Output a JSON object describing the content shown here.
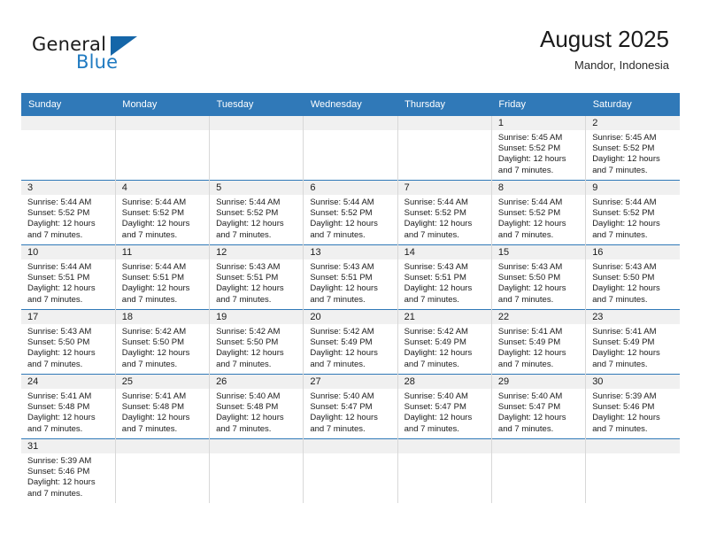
{
  "brand": {
    "name_top": "General",
    "name_bottom": "Blue",
    "triangle_color": "#1566a8",
    "blue_color": "#1f7ac1"
  },
  "header": {
    "title": "August 2025",
    "subtitle": "Mandor, Indonesia",
    "header_bg": "#3079b8",
    "daynum_band_bg": "#f0f0f0"
  },
  "weekdays": [
    "Sunday",
    "Monday",
    "Tuesday",
    "Wednesday",
    "Thursday",
    "Friday",
    "Saturday"
  ],
  "labels": {
    "sunrise_prefix": "Sunrise:",
    "sunset_prefix": "Sunset:",
    "daylight_prefix": "Daylight:"
  },
  "weeks": [
    [
      {
        "day": "",
        "sunrise": "",
        "sunset": "",
        "daylight": "",
        "empty": true
      },
      {
        "day": "",
        "sunrise": "",
        "sunset": "",
        "daylight": "",
        "empty": true
      },
      {
        "day": "",
        "sunrise": "",
        "sunset": "",
        "daylight": "",
        "empty": true
      },
      {
        "day": "",
        "sunrise": "",
        "sunset": "",
        "daylight": "",
        "empty": true
      },
      {
        "day": "",
        "sunrise": "",
        "sunset": "",
        "daylight": "",
        "empty": true
      },
      {
        "day": "1",
        "sunrise": "Sunrise: 5:45 AM",
        "sunset": "Sunset: 5:52 PM",
        "daylight": "Daylight: 12 hours and 7 minutes.",
        "empty": false
      },
      {
        "day": "2",
        "sunrise": "Sunrise: 5:45 AM",
        "sunset": "Sunset: 5:52 PM",
        "daylight": "Daylight: 12 hours and 7 minutes.",
        "empty": false
      }
    ],
    [
      {
        "day": "3",
        "sunrise": "Sunrise: 5:44 AM",
        "sunset": "Sunset: 5:52 PM",
        "daylight": "Daylight: 12 hours and 7 minutes.",
        "empty": false
      },
      {
        "day": "4",
        "sunrise": "Sunrise: 5:44 AM",
        "sunset": "Sunset: 5:52 PM",
        "daylight": "Daylight: 12 hours and 7 minutes.",
        "empty": false
      },
      {
        "day": "5",
        "sunrise": "Sunrise: 5:44 AM",
        "sunset": "Sunset: 5:52 PM",
        "daylight": "Daylight: 12 hours and 7 minutes.",
        "empty": false
      },
      {
        "day": "6",
        "sunrise": "Sunrise: 5:44 AM",
        "sunset": "Sunset: 5:52 PM",
        "daylight": "Daylight: 12 hours and 7 minutes.",
        "empty": false
      },
      {
        "day": "7",
        "sunrise": "Sunrise: 5:44 AM",
        "sunset": "Sunset: 5:52 PM",
        "daylight": "Daylight: 12 hours and 7 minutes.",
        "empty": false
      },
      {
        "day": "8",
        "sunrise": "Sunrise: 5:44 AM",
        "sunset": "Sunset: 5:52 PM",
        "daylight": "Daylight: 12 hours and 7 minutes.",
        "empty": false
      },
      {
        "day": "9",
        "sunrise": "Sunrise: 5:44 AM",
        "sunset": "Sunset: 5:52 PM",
        "daylight": "Daylight: 12 hours and 7 minutes.",
        "empty": false
      }
    ],
    [
      {
        "day": "10",
        "sunrise": "Sunrise: 5:44 AM",
        "sunset": "Sunset: 5:51 PM",
        "daylight": "Daylight: 12 hours and 7 minutes.",
        "empty": false
      },
      {
        "day": "11",
        "sunrise": "Sunrise: 5:44 AM",
        "sunset": "Sunset: 5:51 PM",
        "daylight": "Daylight: 12 hours and 7 minutes.",
        "empty": false
      },
      {
        "day": "12",
        "sunrise": "Sunrise: 5:43 AM",
        "sunset": "Sunset: 5:51 PM",
        "daylight": "Daylight: 12 hours and 7 minutes.",
        "empty": false
      },
      {
        "day": "13",
        "sunrise": "Sunrise: 5:43 AM",
        "sunset": "Sunset: 5:51 PM",
        "daylight": "Daylight: 12 hours and 7 minutes.",
        "empty": false
      },
      {
        "day": "14",
        "sunrise": "Sunrise: 5:43 AM",
        "sunset": "Sunset: 5:51 PM",
        "daylight": "Daylight: 12 hours and 7 minutes.",
        "empty": false
      },
      {
        "day": "15",
        "sunrise": "Sunrise: 5:43 AM",
        "sunset": "Sunset: 5:50 PM",
        "daylight": "Daylight: 12 hours and 7 minutes.",
        "empty": false
      },
      {
        "day": "16",
        "sunrise": "Sunrise: 5:43 AM",
        "sunset": "Sunset: 5:50 PM",
        "daylight": "Daylight: 12 hours and 7 minutes.",
        "empty": false
      }
    ],
    [
      {
        "day": "17",
        "sunrise": "Sunrise: 5:43 AM",
        "sunset": "Sunset: 5:50 PM",
        "daylight": "Daylight: 12 hours and 7 minutes.",
        "empty": false
      },
      {
        "day": "18",
        "sunrise": "Sunrise: 5:42 AM",
        "sunset": "Sunset: 5:50 PM",
        "daylight": "Daylight: 12 hours and 7 minutes.",
        "empty": false
      },
      {
        "day": "19",
        "sunrise": "Sunrise: 5:42 AM",
        "sunset": "Sunset: 5:50 PM",
        "daylight": "Daylight: 12 hours and 7 minutes.",
        "empty": false
      },
      {
        "day": "20",
        "sunrise": "Sunrise: 5:42 AM",
        "sunset": "Sunset: 5:49 PM",
        "daylight": "Daylight: 12 hours and 7 minutes.",
        "empty": false
      },
      {
        "day": "21",
        "sunrise": "Sunrise: 5:42 AM",
        "sunset": "Sunset: 5:49 PM",
        "daylight": "Daylight: 12 hours and 7 minutes.",
        "empty": false
      },
      {
        "day": "22",
        "sunrise": "Sunrise: 5:41 AM",
        "sunset": "Sunset: 5:49 PM",
        "daylight": "Daylight: 12 hours and 7 minutes.",
        "empty": false
      },
      {
        "day": "23",
        "sunrise": "Sunrise: 5:41 AM",
        "sunset": "Sunset: 5:49 PM",
        "daylight": "Daylight: 12 hours and 7 minutes.",
        "empty": false
      }
    ],
    [
      {
        "day": "24",
        "sunrise": "Sunrise: 5:41 AM",
        "sunset": "Sunset: 5:48 PM",
        "daylight": "Daylight: 12 hours and 7 minutes.",
        "empty": false
      },
      {
        "day": "25",
        "sunrise": "Sunrise: 5:41 AM",
        "sunset": "Sunset: 5:48 PM",
        "daylight": "Daylight: 12 hours and 7 minutes.",
        "empty": false
      },
      {
        "day": "26",
        "sunrise": "Sunrise: 5:40 AM",
        "sunset": "Sunset: 5:48 PM",
        "daylight": "Daylight: 12 hours and 7 minutes.",
        "empty": false
      },
      {
        "day": "27",
        "sunrise": "Sunrise: 5:40 AM",
        "sunset": "Sunset: 5:47 PM",
        "daylight": "Daylight: 12 hours and 7 minutes.",
        "empty": false
      },
      {
        "day": "28",
        "sunrise": "Sunrise: 5:40 AM",
        "sunset": "Sunset: 5:47 PM",
        "daylight": "Daylight: 12 hours and 7 minutes.",
        "empty": false
      },
      {
        "day": "29",
        "sunrise": "Sunrise: 5:40 AM",
        "sunset": "Sunset: 5:47 PM",
        "daylight": "Daylight: 12 hours and 7 minutes.",
        "empty": false
      },
      {
        "day": "30",
        "sunrise": "Sunrise: 5:39 AM",
        "sunset": "Sunset: 5:46 PM",
        "daylight": "Daylight: 12 hours and 7 minutes.",
        "empty": false
      }
    ],
    [
      {
        "day": "31",
        "sunrise": "Sunrise: 5:39 AM",
        "sunset": "Sunset: 5:46 PM",
        "daylight": "Daylight: 12 hours and 7 minutes.",
        "empty": false
      },
      {
        "day": "",
        "sunrise": "",
        "sunset": "",
        "daylight": "",
        "empty": true
      },
      {
        "day": "",
        "sunrise": "",
        "sunset": "",
        "daylight": "",
        "empty": true
      },
      {
        "day": "",
        "sunrise": "",
        "sunset": "",
        "daylight": "",
        "empty": true
      },
      {
        "day": "",
        "sunrise": "",
        "sunset": "",
        "daylight": "",
        "empty": true
      },
      {
        "day": "",
        "sunrise": "",
        "sunset": "",
        "daylight": "",
        "empty": true
      },
      {
        "day": "",
        "sunrise": "",
        "sunset": "",
        "daylight": "",
        "empty": true
      }
    ]
  ]
}
